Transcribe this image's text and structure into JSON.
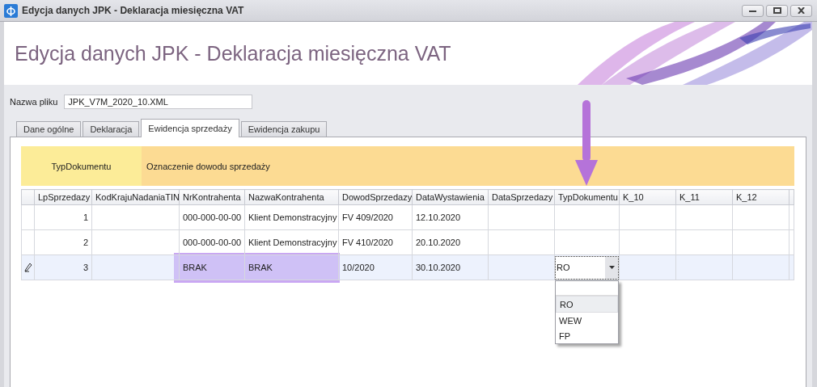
{
  "window": {
    "title": "Edycja danych JPK - Deklaracja miesięczna VAT"
  },
  "banner": {
    "title": "Edycja danych JPK - Deklaracja miesięczna VAT"
  },
  "file_name": {
    "label": "Nazwa pliku",
    "value": "JPK_V7M_2020_10.XML"
  },
  "tabs": [
    {
      "label": "Dane ogólne",
      "selected": false
    },
    {
      "label": "Deklaracja",
      "selected": false
    },
    {
      "label": "Ewidencja sprzedaży",
      "selected": true
    },
    {
      "label": "Ewidencja zakupu",
      "selected": false
    }
  ],
  "group_band": [
    {
      "label": "TypDokumentu",
      "kind": "field"
    },
    {
      "label": "Oznaczenie dowodu sprzedaży",
      "kind": "description"
    }
  ],
  "table": {
    "columns": [
      {
        "label": "LpSprzedazy",
        "kind": "number"
      },
      {
        "label": "KodKrajuNadaniaTIN",
        "kind": "text"
      },
      {
        "label": "NrKontrahenta",
        "kind": "text"
      },
      {
        "label": "NazwaKontrahenta",
        "kind": "text"
      },
      {
        "label": "DowodSprzedazy",
        "kind": "text"
      },
      {
        "label": "DataWystawienia",
        "kind": "text"
      },
      {
        "label": "DataSprzedazy",
        "kind": "text"
      },
      {
        "label": "TypDokumentu",
        "kind": "text"
      },
      {
        "label": "K_10",
        "kind": "text"
      },
      {
        "label": "K_11",
        "kind": "text"
      },
      {
        "label": "K_12",
        "kind": "text"
      }
    ],
    "rows": [
      {
        "selected": false,
        "cells": [
          "1",
          null,
          "000-000-00-00",
          "Klient Demonstracyjny",
          "FV 409/2020",
          "12.10.2020",
          null,
          null,
          null,
          null,
          null
        ]
      },
      {
        "selected": false,
        "cells": [
          "2",
          null,
          "000-000-00-00",
          "Klient Demonstracyjny",
          "FV 410/2020",
          "20.10.2020",
          null,
          null,
          null,
          null,
          null
        ]
      },
      {
        "selected": true,
        "cells": [
          "3",
          null,
          "BRAK",
          "BRAK",
          "10/2020",
          "30.10.2020",
          null,
          {
            "kind": "combo",
            "value": "RO"
          },
          null,
          null,
          null
        ]
      }
    ]
  },
  "dropdown": {
    "items": [
      {
        "label": "RO",
        "selected": true
      },
      {
        "label": "WEW",
        "selected": false
      },
      {
        "label": "FP",
        "selected": false
      }
    ]
  }
}
